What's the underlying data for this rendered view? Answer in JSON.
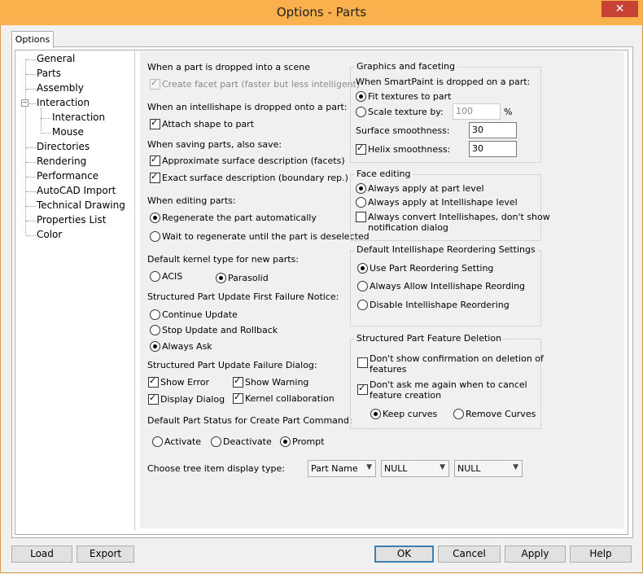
{
  "window": {
    "title": "Options - Parts",
    "close_glyph": "✕"
  },
  "tab": "Options",
  "tree": [
    {
      "label": "General"
    },
    {
      "label": "Parts"
    },
    {
      "label": "Assembly"
    },
    {
      "label": "Interaction",
      "expander": "−"
    },
    {
      "label": "Interaction"
    },
    {
      "label": "Mouse"
    },
    {
      "label": "Directories"
    },
    {
      "label": "Rendering"
    },
    {
      "label": "Performance"
    },
    {
      "label": "AutoCAD Import"
    },
    {
      "label": "Technical Drawing"
    },
    {
      "label": "Properties List"
    },
    {
      "label": "Color"
    }
  ],
  "left": {
    "drop_heading": "When a part is dropped into a scene",
    "create_facet": "Create facet part (faster but less intelligent)",
    "intellishape_heading": "When an intellishape is dropped onto a part:",
    "attach_shape": "Attach shape to part",
    "saving_heading": "When saving parts, also save:",
    "approx_surface": "Approximate surface description (facets)",
    "exact_surface": "Exact surface description (boundary rep.)",
    "editing_heading": "When editing parts:",
    "regenerate_auto": "Regenerate the part automatically",
    "wait_regenerate": "Wait to regenerate until the part is deselected",
    "kernel_heading": "Default kernel type for new parts:",
    "acis": "ACIS",
    "parasolid": "Parasolid",
    "first_failure_heading": "Structured Part Update First Failure Notice:",
    "continue_update": "Continue Update",
    "stop_update": "Stop Update and Rollback",
    "always_ask": "Always Ask",
    "failure_dialog_heading": "Structured Part Update Failure Dialog:",
    "show_error": "Show Error",
    "show_warning": "Show Warning",
    "display_dialog": "Display Dialog",
    "kernel_collab": "Kernel collaboration",
    "status_heading": "Default Part Status for Create Part Command:",
    "activate": "Activate",
    "deactivate": "Deactivate",
    "prompt": "Prompt",
    "tree_display_label": "Choose tree item display type:",
    "tree_display_values": [
      "Part Name",
      "NULL",
      "NULL"
    ]
  },
  "graphics": {
    "title": "Graphics and faceting",
    "smartpaint_heading": "When SmartPaint is dropped on a part:",
    "fit_textures": "Fit textures to part",
    "scale_texture": "Scale texture by:",
    "scale_value": "100",
    "scale_unit": "%",
    "surface_smoothness": "Surface smoothness:",
    "surface_value": "30",
    "helix_smoothness": "Helix smoothness:",
    "helix_value": "30"
  },
  "face_editing": {
    "title": "Face editing",
    "part_level": "Always apply at part level",
    "intellishape_level": "Always apply at Intellishape level",
    "convert_line1": "Always convert Intellishapes, don't show",
    "convert_line2": "notification dialog"
  },
  "reordering": {
    "title": "Default Intellishape Reordering Settings",
    "use_part": "Use Part Reordering Setting",
    "always_allow": "Always Allow Intellishape Reording",
    "disable": "Disable Intellishape Reordering"
  },
  "feature_deletion": {
    "title": "Structured Part Feature Deletion",
    "dont_show_1": "Don't show confirmation on deletion of",
    "dont_show_2": "features",
    "dont_ask_1": "Don't ask me again when to cancel",
    "dont_ask_2": "feature creation",
    "keep_curves": "Keep curves",
    "remove_curves": "Remove Curves"
  },
  "buttons": {
    "load": "Load",
    "export": "Export",
    "ok": "OK",
    "cancel": "Cancel",
    "apply": "Apply",
    "help": "Help"
  },
  "colors": {
    "titlebar": "#f9b04d",
    "close": "#c74234"
  }
}
